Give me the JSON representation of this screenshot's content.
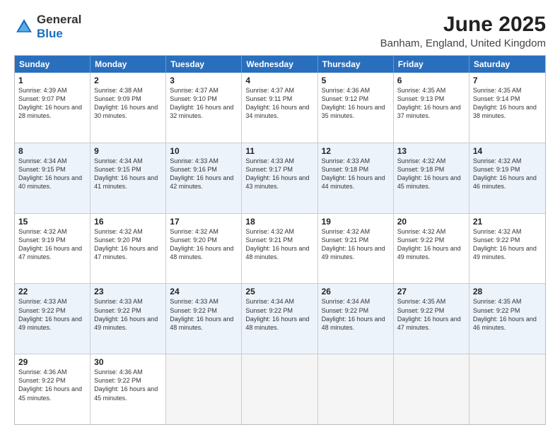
{
  "logo": {
    "general": "General",
    "blue": "Blue"
  },
  "title": "June 2025",
  "subtitle": "Banham, England, United Kingdom",
  "headers": [
    "Sunday",
    "Monday",
    "Tuesday",
    "Wednesday",
    "Thursday",
    "Friday",
    "Saturday"
  ],
  "weeks": [
    [
      {
        "day": "1",
        "sunrise": "4:39 AM",
        "sunset": "9:07 PM",
        "daylight": "16 hours and 28 minutes."
      },
      {
        "day": "2",
        "sunrise": "4:38 AM",
        "sunset": "9:09 PM",
        "daylight": "16 hours and 30 minutes."
      },
      {
        "day": "3",
        "sunrise": "4:37 AM",
        "sunset": "9:10 PM",
        "daylight": "16 hours and 32 minutes."
      },
      {
        "day": "4",
        "sunrise": "4:37 AM",
        "sunset": "9:11 PM",
        "daylight": "16 hours and 34 minutes."
      },
      {
        "day": "5",
        "sunrise": "4:36 AM",
        "sunset": "9:12 PM",
        "daylight": "16 hours and 35 minutes."
      },
      {
        "day": "6",
        "sunrise": "4:35 AM",
        "sunset": "9:13 PM",
        "daylight": "16 hours and 37 minutes."
      },
      {
        "day": "7",
        "sunrise": "4:35 AM",
        "sunset": "9:14 PM",
        "daylight": "16 hours and 38 minutes."
      }
    ],
    [
      {
        "day": "8",
        "sunrise": "4:34 AM",
        "sunset": "9:15 PM",
        "daylight": "16 hours and 40 minutes."
      },
      {
        "day": "9",
        "sunrise": "4:34 AM",
        "sunset": "9:15 PM",
        "daylight": "16 hours and 41 minutes."
      },
      {
        "day": "10",
        "sunrise": "4:33 AM",
        "sunset": "9:16 PM",
        "daylight": "16 hours and 42 minutes."
      },
      {
        "day": "11",
        "sunrise": "4:33 AM",
        "sunset": "9:17 PM",
        "daylight": "16 hours and 43 minutes."
      },
      {
        "day": "12",
        "sunrise": "4:33 AM",
        "sunset": "9:18 PM",
        "daylight": "16 hours and 44 minutes."
      },
      {
        "day": "13",
        "sunrise": "4:32 AM",
        "sunset": "9:18 PM",
        "daylight": "16 hours and 45 minutes."
      },
      {
        "day": "14",
        "sunrise": "4:32 AM",
        "sunset": "9:19 PM",
        "daylight": "16 hours and 46 minutes."
      }
    ],
    [
      {
        "day": "15",
        "sunrise": "4:32 AM",
        "sunset": "9:19 PM",
        "daylight": "16 hours and 47 minutes."
      },
      {
        "day": "16",
        "sunrise": "4:32 AM",
        "sunset": "9:20 PM",
        "daylight": "16 hours and 47 minutes."
      },
      {
        "day": "17",
        "sunrise": "4:32 AM",
        "sunset": "9:20 PM",
        "daylight": "16 hours and 48 minutes."
      },
      {
        "day": "18",
        "sunrise": "4:32 AM",
        "sunset": "9:21 PM",
        "daylight": "16 hours and 48 minutes."
      },
      {
        "day": "19",
        "sunrise": "4:32 AM",
        "sunset": "9:21 PM",
        "daylight": "16 hours and 49 minutes."
      },
      {
        "day": "20",
        "sunrise": "4:32 AM",
        "sunset": "9:22 PM",
        "daylight": "16 hours and 49 minutes."
      },
      {
        "day": "21",
        "sunrise": "4:32 AM",
        "sunset": "9:22 PM",
        "daylight": "16 hours and 49 minutes."
      }
    ],
    [
      {
        "day": "22",
        "sunrise": "4:33 AM",
        "sunset": "9:22 PM",
        "daylight": "16 hours and 49 minutes."
      },
      {
        "day": "23",
        "sunrise": "4:33 AM",
        "sunset": "9:22 PM",
        "daylight": "16 hours and 49 minutes."
      },
      {
        "day": "24",
        "sunrise": "4:33 AM",
        "sunset": "9:22 PM",
        "daylight": "16 hours and 48 minutes."
      },
      {
        "day": "25",
        "sunrise": "4:34 AM",
        "sunset": "9:22 PM",
        "daylight": "16 hours and 48 minutes."
      },
      {
        "day": "26",
        "sunrise": "4:34 AM",
        "sunset": "9:22 PM",
        "daylight": "16 hours and 48 minutes."
      },
      {
        "day": "27",
        "sunrise": "4:35 AM",
        "sunset": "9:22 PM",
        "daylight": "16 hours and 47 minutes."
      },
      {
        "day": "28",
        "sunrise": "4:35 AM",
        "sunset": "9:22 PM",
        "daylight": "16 hours and 46 minutes."
      }
    ],
    [
      {
        "day": "29",
        "sunrise": "4:36 AM",
        "sunset": "9:22 PM",
        "daylight": "16 hours and 45 minutes."
      },
      {
        "day": "30",
        "sunrise": "4:36 AM",
        "sunset": "9:22 PM",
        "daylight": "16 hours and 45 minutes."
      },
      null,
      null,
      null,
      null,
      null
    ]
  ]
}
